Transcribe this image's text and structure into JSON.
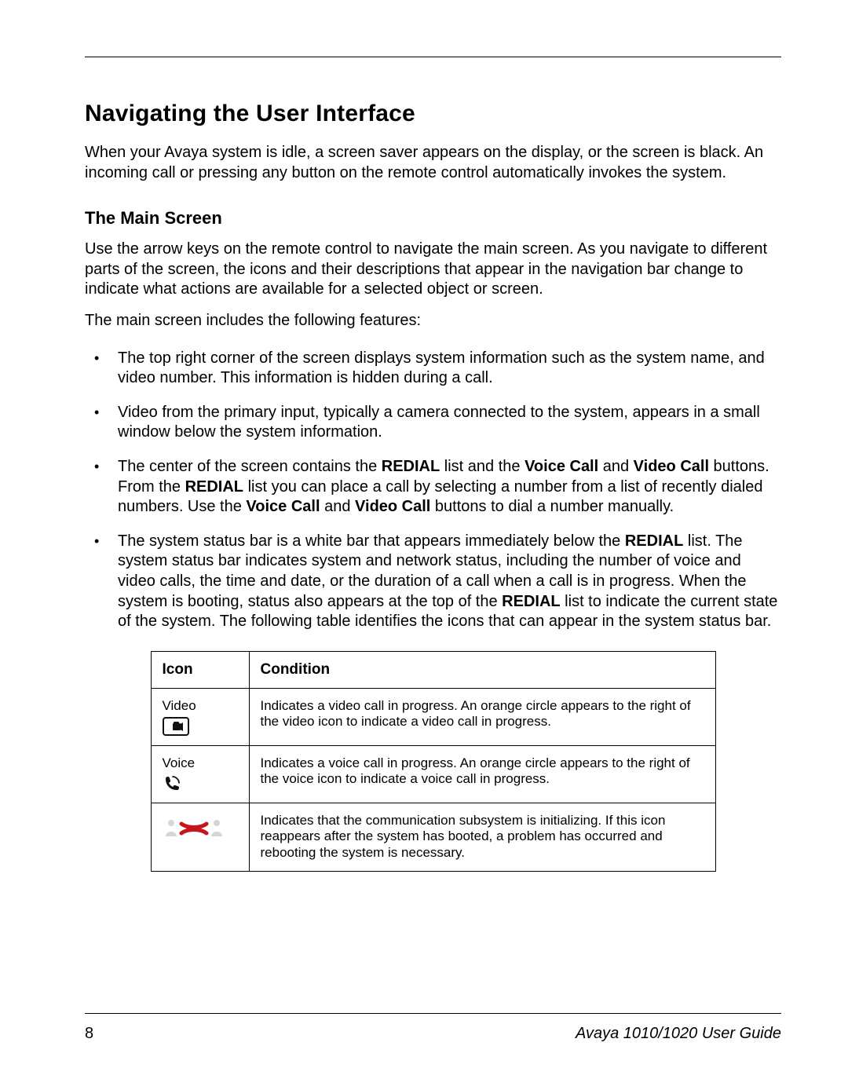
{
  "title": "Navigating the User Interface",
  "intro": "When your Avaya system is idle, a screen saver appears on the display, or the screen is black. An incoming call or pressing any button on the remote control automatically invokes the system.",
  "subtitle": "The Main Screen",
  "para1": "Use the arrow keys on the remote control to navigate the main screen. As you navigate to different parts of the screen, the icons and their descriptions that appear in the navigation bar change to indicate what actions are available for a selected object or screen.",
  "para2": "The main screen includes the following features:",
  "features": {
    "b1": "The top right corner of the screen displays system information such as the system name, and video number. This information is hidden during a call.",
    "b2": "Video from the primary input, typically a camera connected to the system, appears in a small window below the system information.",
    "b3_pre": "The center of the screen contains the ",
    "b3_redial1": "REDIAL",
    "b3_mid1": " list and the ",
    "b3_voice": "Voice Call",
    "b3_and": " and ",
    "b3_video": "Video Call",
    "b3_mid2": " buttons. From the ",
    "b3_redial2": "REDIAL",
    "b3_mid3": " list you can place a call by selecting a number from a list of recently dialed numbers. Use the ",
    "b3_voice2": "Voice Call",
    "b3_and2": " and ",
    "b3_video2": "Video Call",
    "b3_tail": " buttons to dial a number manually.",
    "b4_pre": "The system status bar is a white bar that appears immediately below the ",
    "b4_redial1": "REDIAL",
    "b4_mid1": " list. The system status bar indicates system and network status, including the number of voice and video calls, the time and date, or the duration of a call when a call is in progress. When the system is booting, status also appears at the top of the ",
    "b4_redial2": "REDIAL",
    "b4_tail": " list to indicate the current state of the system. The following table identifies the icons that can appear in the system status bar."
  },
  "table": {
    "head_icon": "Icon",
    "head_cond": "Condition",
    "rows": [
      {
        "icon_label": "Video",
        "condition": "Indicates a video call in progress. An orange circle appears to the right of the video icon to indicate a video call in progress."
      },
      {
        "icon_label": "Voice",
        "condition": "Indicates a voice call in progress. An orange circle appears to the right of the voice icon to indicate a voice call in progress."
      },
      {
        "icon_label": "",
        "condition": "Indicates that the communication subsystem is initializing. If this icon reappears after the system has booted, a problem has occurred and rebooting the system is necessary."
      }
    ]
  },
  "footer": {
    "page_number": "8",
    "guide": "Avaya 1010/1020 User Guide"
  }
}
